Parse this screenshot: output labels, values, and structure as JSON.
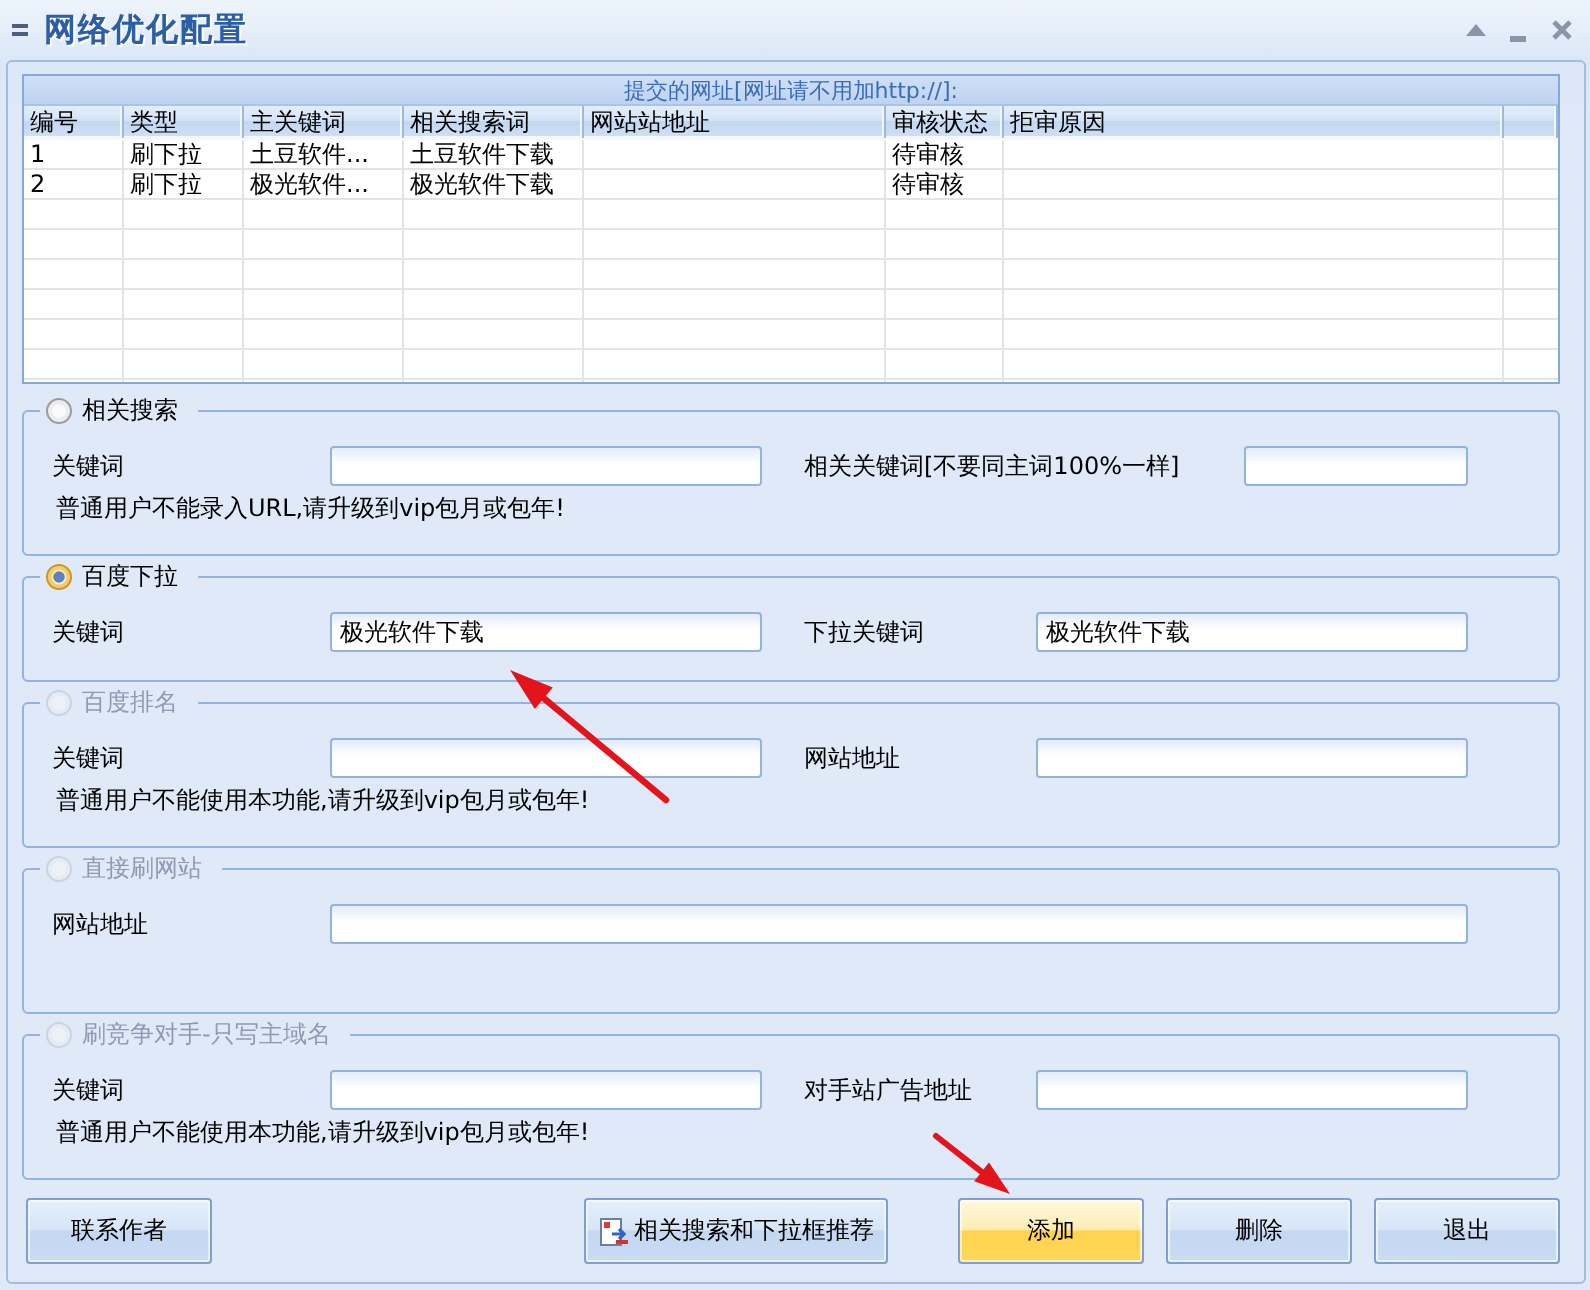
{
  "window": {
    "title": "网络优化配置"
  },
  "table": {
    "caption": "提交的网址[网址请不用加http://]:",
    "columns": [
      "编号",
      "类型",
      "主关键词",
      "相关搜索词",
      "网站站地址",
      "审核状态",
      "拒审原因"
    ],
    "rows": [
      {
        "number": "1",
        "type": "刷下拉",
        "main_keyword": "土豆软件...",
        "related_search": "土豆软件下载",
        "status": "待审核"
      },
      {
        "number": "2",
        "type": "刷下拉",
        "main_keyword": "极光软件...",
        "related_search": "极光软件下载",
        "status": "待审核"
      }
    ]
  },
  "sections": [
    {
      "title": "相关搜索",
      "selected": false,
      "disabled": false,
      "fields": [
        {
          "label": "关键词"
        },
        {
          "label": "相关关键词[不要同主词100%一样]"
        }
      ],
      "note": "普通用户不能录入URL,请升级到vip包月或包年!"
    },
    {
      "title": "百度下拉",
      "selected": true,
      "disabled": false,
      "fields": [
        {
          "label": "关键词",
          "value": "极光软件下载"
        },
        {
          "label": "下拉关键词",
          "value": "极光软件下载"
        }
      ]
    },
    {
      "title": "百度排名",
      "selected": false,
      "disabled": true,
      "fields": [
        {
          "label": "关键词"
        },
        {
          "label": "网站地址"
        }
      ],
      "note": "普通用户不能使用本功能,请升级到vip包月或包年!"
    },
    {
      "title": "直接刷网站",
      "selected": false,
      "disabled": true,
      "fields": [
        {
          "label": "网站地址"
        }
      ]
    },
    {
      "title": "刷竞争对手-只写主域名",
      "selected": false,
      "disabled": true,
      "fields": [
        {
          "label": "关键词"
        },
        {
          "label": "对手站广告地址"
        }
      ],
      "note": "普通用户不能使用本功能,请升级到vip包月或包年!"
    }
  ],
  "buttons": [
    {
      "label": "联系作者",
      "kind": "text",
      "highlighted": false
    },
    {
      "label": "相关搜索和下拉框推荐",
      "kind": "icon_text",
      "highlighted": false
    },
    {
      "label": "添加",
      "kind": "text",
      "highlighted": true
    },
    {
      "label": "删除",
      "kind": "text",
      "highlighted": false
    },
    {
      "label": "退出",
      "kind": "text",
      "highlighted": false
    }
  ]
}
